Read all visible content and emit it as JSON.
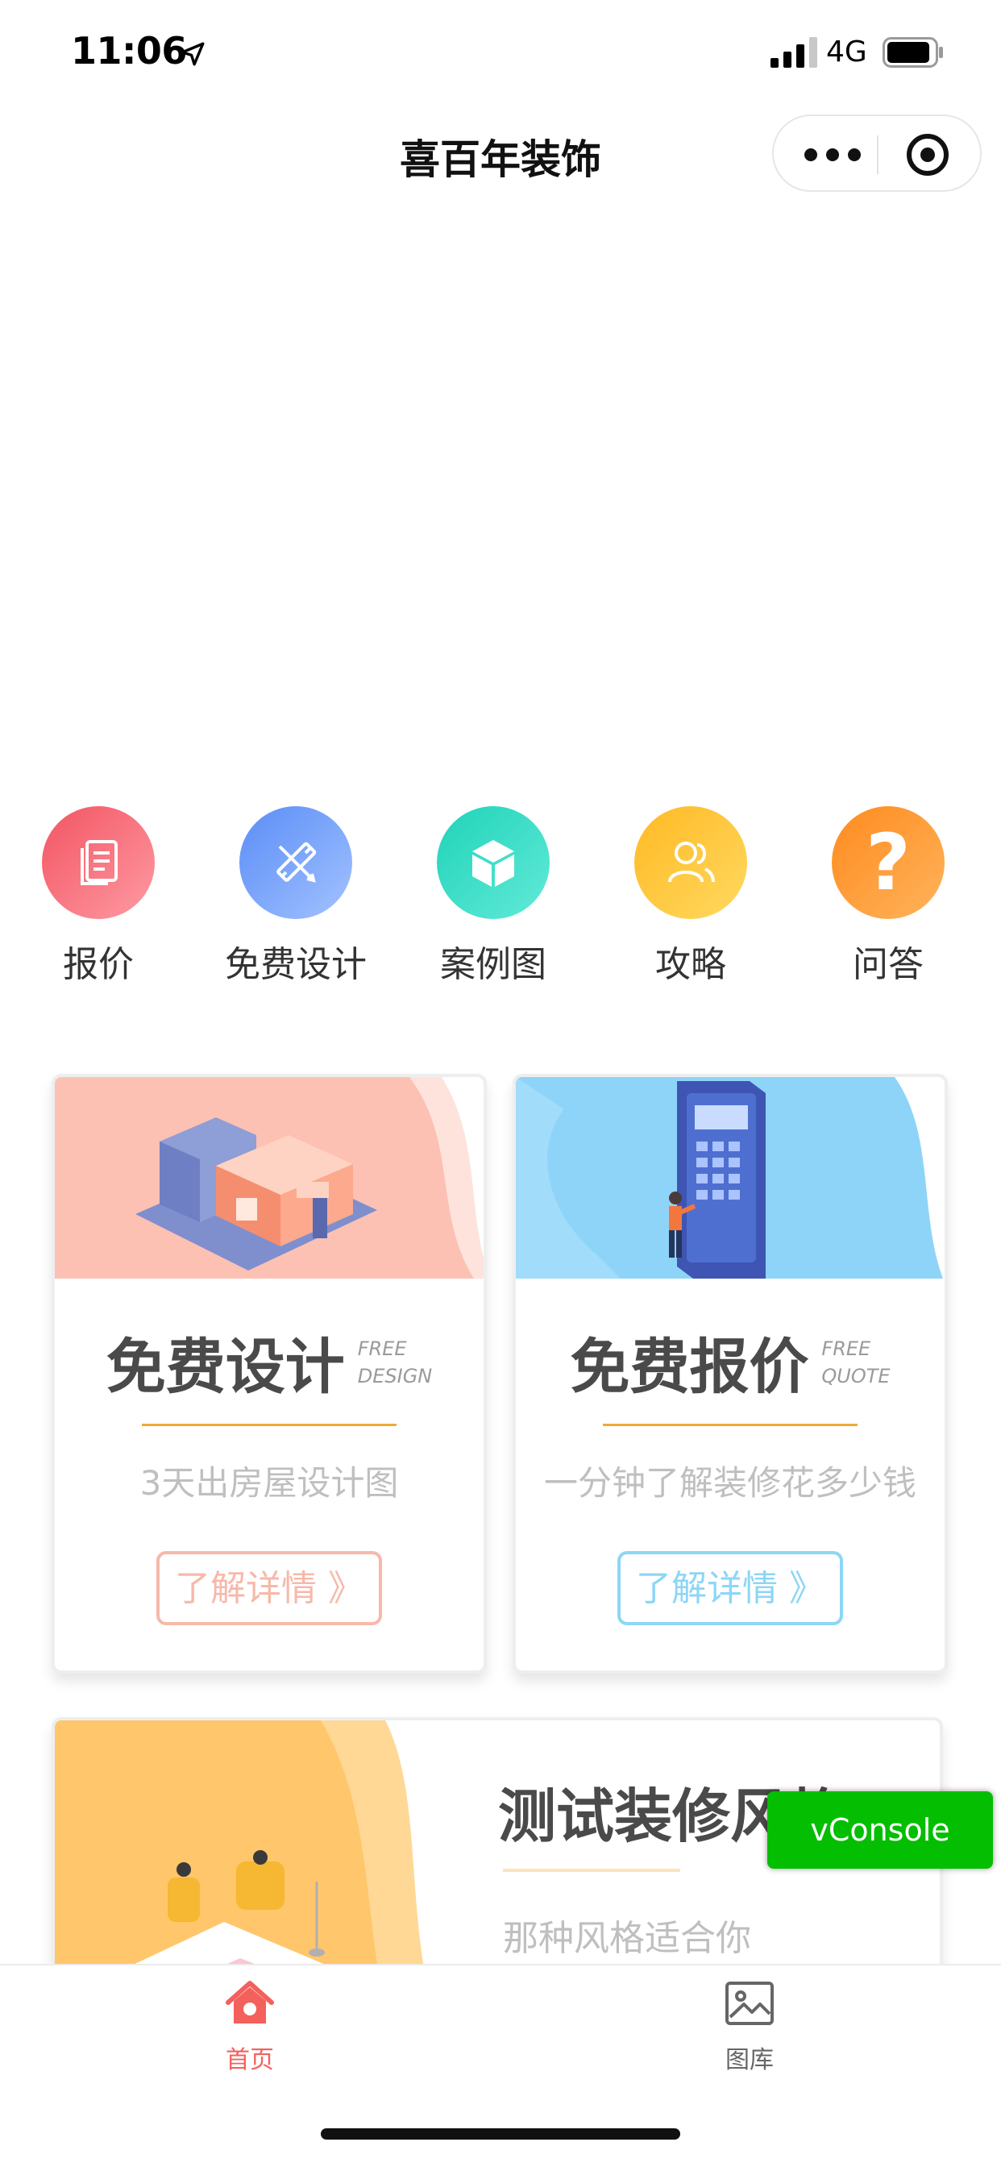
{
  "status_bar": {
    "time": "11:06",
    "network": "4G",
    "icons": [
      "location-arrow-icon",
      "signal-bars-icon",
      "battery-icon"
    ]
  },
  "nav": {
    "title": "喜百年装饰",
    "capsule_icons": [
      "more-dots-icon",
      "close-target-icon"
    ]
  },
  "menu": {
    "items": [
      {
        "label": "报价",
        "icon": "document-icon",
        "color": "#fb7480"
      },
      {
        "label": "免费设计",
        "icon": "ruler-pencil-icon",
        "color": "#6d9ffb"
      },
      {
        "label": "案例图",
        "icon": "cube-icon",
        "color": "#35dcc8"
      },
      {
        "label": "攻略",
        "icon": "users-icon",
        "color": "#ffc42e"
      },
      {
        "label": "问答",
        "icon": "question-icon",
        "color": "#ff9a2e"
      }
    ]
  },
  "cards": [
    {
      "title": "免费设计",
      "en_line1": "FREE",
      "en_line2": "DESIGN",
      "subtitle": "3天出房屋设计图",
      "button": "了解详情 》",
      "accent": "#f6b9aa",
      "image_bg": "#fcc1b3"
    },
    {
      "title": "免费报价",
      "en_line1": "FREE",
      "en_line2": "QUOTE",
      "subtitle": "一分钟了解装修花多少钱",
      "button": "了解详情 》",
      "accent": "#8dd6f6",
      "image_bg": "#8ed4f8"
    }
  ],
  "style_card": {
    "title": "测试装修风格",
    "subtitle": "那种风格适合你",
    "image_bg": "#ffc66c"
  },
  "vconsole": {
    "label": "vConsole",
    "color": "#04be02"
  },
  "tabbar": {
    "tabs": [
      {
        "label": "首页",
        "icon": "home-icon",
        "active": true,
        "color": "#f4605c"
      },
      {
        "label": "图库",
        "icon": "gallery-icon",
        "active": false,
        "color": "#666666"
      }
    ]
  }
}
